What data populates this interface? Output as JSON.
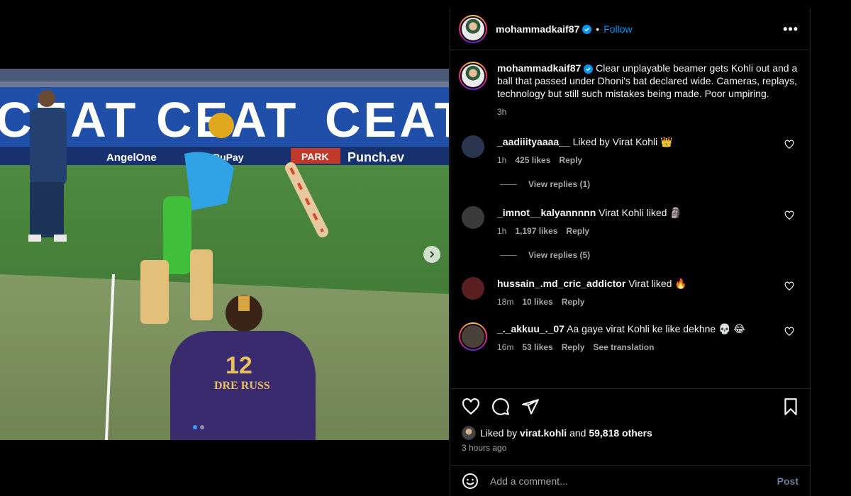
{
  "header": {
    "username": "mohammadkaif87",
    "separator": "•",
    "follow_label": "Follow",
    "more_label": "•••"
  },
  "caption": {
    "username": "mohammadkaif87",
    "text": "Clear unplayable beamer gets Kohli out and a ball that passed under Dhoni's bat declared wide. Cameras, replays, technology but still such mistakes being made. Poor umpiring.",
    "time": "3h"
  },
  "comments": [
    {
      "username": "_aadiiityaaaa__",
      "text": "Liked by Virat Kohli 👑",
      "time": "1h",
      "likes": "425 likes",
      "reply": "Reply",
      "view_replies": "View replies (1)",
      "avatar_color": "#2a3550"
    },
    {
      "username": "_imnot__kalyannnnn",
      "text": "Virat Kohli liked 🗿",
      "time": "1h",
      "likes": "1,197 likes",
      "reply": "Reply",
      "view_replies": "View replies (5)",
      "avatar_color": "#3a3a3a"
    },
    {
      "username": "hussain_.md_cric_addictor",
      "text": "Virat liked 🔥",
      "time": "18m",
      "likes": "10 likes",
      "reply": "Reply",
      "avatar_color": "#5a1f22"
    },
    {
      "username": "_._akkuu_._07",
      "text": "Aa gaye virat Kohli ke like dekhne 💀 😂",
      "time": "16m",
      "likes": "53 likes",
      "reply": "Reply",
      "see_translation": "See translation",
      "avatar_color": "#4a4238"
    }
  ],
  "likes": {
    "prefix": "Liked by",
    "user": "virat.kohli",
    "and": "and",
    "others": "59,818 others"
  },
  "posted_time": "3 hours ago",
  "add_comment": {
    "placeholder": "Add a comment...",
    "post_label": "Post"
  },
  "photo": {
    "sponsor_text": "CEAT",
    "board_texts": [
      "AngelOne",
      "RuPay",
      "PARK",
      "Punch.ev"
    ],
    "jersey_number": "12",
    "jersey_name": "DRE RUSS",
    "carousel_count": 2,
    "carousel_active": 0
  },
  "colors": {
    "accent": "#0095f6",
    "background": "#000000",
    "muted": "#a8a8a8",
    "divider": "#262626"
  }
}
